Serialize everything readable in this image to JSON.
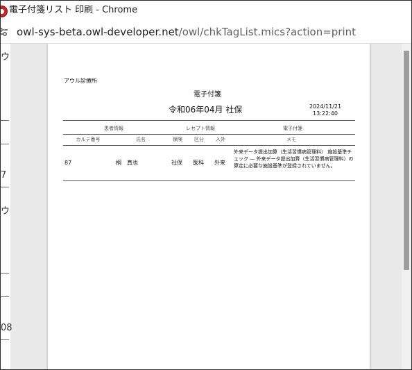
{
  "window": {
    "title": "電子付箋リスト 印刷 - Chrome"
  },
  "address_bar": {
    "url_host": "owl-sys-beta.owl-developer.net",
    "url_path": "/owl/chkTagList.mics?action=print"
  },
  "background_fragments": [
    "ウ",
    "7",
    "ウ",
    "08"
  ],
  "document": {
    "clinic_name": "アウル診療所",
    "title": "電子付箋",
    "subtitle": "令和06年04月  社保",
    "print_date": "2024/11/21",
    "print_time": "13:22:40",
    "group_headers": {
      "patient": "患者情報",
      "receipt": "レセプト情報",
      "tag": "電子付箋"
    },
    "columns": {
      "chart_no": "カルテ番号",
      "name": "氏名",
      "insurance": "保険",
      "category": "区分",
      "in_out": "入外",
      "memo": "メモ"
    },
    "rows": [
      {
        "chart_no": "87",
        "name": "桐　真也",
        "insurance": "社保",
        "category": "医科",
        "in_out": "外来",
        "memo": "外来データ提出加算（生活習慣病管理料） 施設基準チェック ― 外来データ提出加算（生活習慣病管理料）の算定に必要な施設基準が登録されていません。"
      }
    ]
  },
  "icons": {
    "app": "chrome-app-icon",
    "site_info": "site-info-icon"
  }
}
